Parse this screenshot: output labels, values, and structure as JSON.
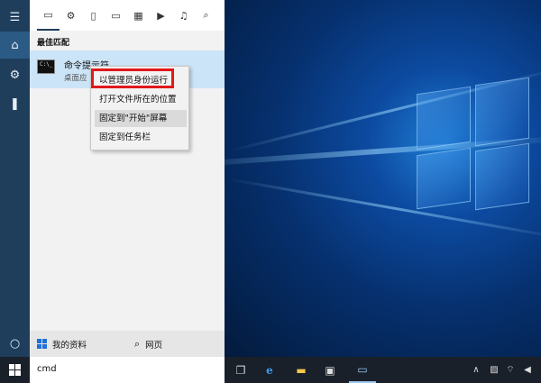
{
  "search": {
    "query": "cmd"
  },
  "filters": [
    "apps-icon",
    "settings-icon",
    "document-icon",
    "folder-icon",
    "photo-icon",
    "video-icon",
    "music-icon",
    "search-icon"
  ],
  "panel": {
    "best_match_label": "最佳匹配",
    "result": {
      "title": "命令提示符",
      "subtitle": "桌面应"
    }
  },
  "context_menu": {
    "items": [
      "以管理员身份运行",
      "打开文件所在的位置",
      "固定到\"开始\"屏幕",
      "固定到任务栏"
    ]
  },
  "bottom": {
    "my_stuff": "我的资料",
    "web": "网页"
  },
  "colors": {
    "highlight": "#e0191a",
    "selected_result": "#cce4f7",
    "rail": "#1e3e5c"
  }
}
